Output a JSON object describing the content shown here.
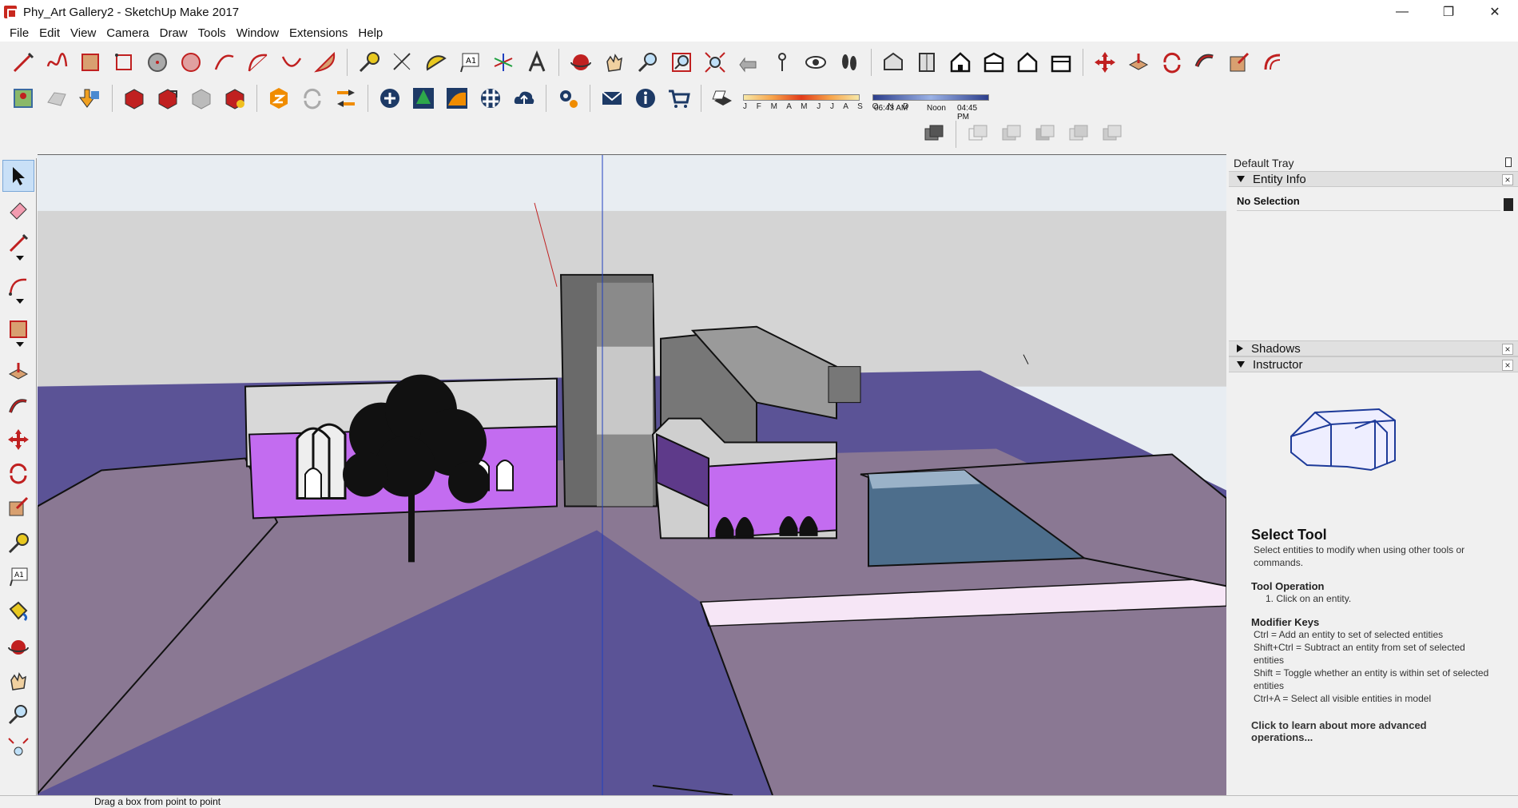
{
  "window": {
    "title": "Phy_Art Gallery2 - SketchUp Make 2017",
    "controls": {
      "minimize": "—",
      "maximize": "❐",
      "close": "✕"
    }
  },
  "menu": [
    "File",
    "Edit",
    "View",
    "Camera",
    "Draw",
    "Tools",
    "Window",
    "Extensions",
    "Help"
  ],
  "toolbar": {
    "shadow_months": "J F M A M J J A S O N D",
    "sunrise": "06:43 AM",
    "noon": "Noon",
    "sunset": "04:45 PM",
    "text_tool_label": "A1"
  },
  "left_tools": {
    "text_tool_label": "A1",
    "active_tool": "select"
  },
  "tray": {
    "title": "Default Tray",
    "entity_info": {
      "header": "Entity Info",
      "selection": "No Selection"
    },
    "shadows": {
      "header": "Shadows"
    },
    "instructor": {
      "header": "Instructor",
      "tool_title": "Select Tool",
      "tool_desc": "Select entities to modify when using other tools or commands.",
      "op_header": "Tool Operation",
      "op_step": "1. Click on an entity.",
      "mod_header": "Modifier Keys",
      "mod_1": "Ctrl = Add an entity to set of selected entities",
      "mod_2": "Shift+Ctrl = Subtract an entity from set of selected entities",
      "mod_3": "Shift = Toggle whether an entity is within set of selected entities",
      "mod_4": "Ctrl+A = Select all visible entities in model",
      "link": "Click to learn about more advanced operations..."
    }
  },
  "status": {
    "text": "Drag a box from point to point"
  },
  "colors": {
    "ground": "#8a7893",
    "water_plane": "#5b5396",
    "wall_violet": "#c36cf0",
    "pool": "#4d6e8c",
    "sky": "#e8edf2"
  }
}
